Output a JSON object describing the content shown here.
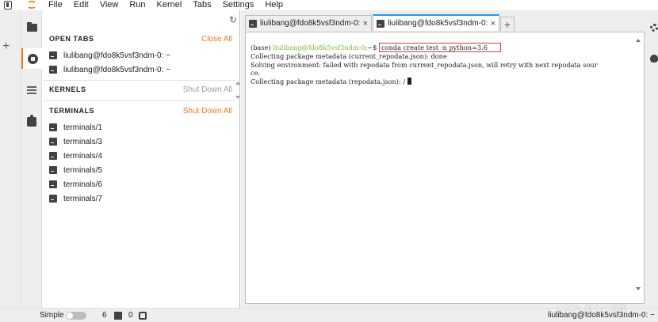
{
  "menubar": {
    "items": [
      "File",
      "Edit",
      "View",
      "Run",
      "Kernel",
      "Tabs",
      "Settings",
      "Help"
    ]
  },
  "icons": {
    "app": "window-icon",
    "logo": "jupyter-logo",
    "add_launcher": "plus-icon",
    "sidebar": [
      "folder-icon",
      "running-icon",
      "list-icon",
      "puzzle-icon"
    ],
    "right": [
      "gear-icon",
      "bug-icon"
    ]
  },
  "panel": {
    "open_tabs": {
      "title": "OPEN TABS",
      "action": "Close All",
      "items": [
        "liulibang@fdo8k5vsf3ndm-0: ~",
        "liulibang@fdo8k5vsf3ndm-0: ~"
      ]
    },
    "kernels": {
      "title": "KERNELS",
      "action": "Shut Down All"
    },
    "terminals": {
      "title": "TERMINALS",
      "action": "Shut Down All",
      "items": [
        "terminals/1",
        "terminals/3",
        "terminals/4",
        "terminals/5",
        "terminals/6",
        "terminals/7"
      ]
    }
  },
  "tabs": [
    {
      "label": "liulibang@fdo8k5vsf3ndm-0:",
      "close": "×",
      "active": false
    },
    {
      "label": "liulibang@fdo8k5vsf3ndm-0:",
      "close": "×",
      "active": true
    }
  ],
  "add_tab": "+",
  "terminal": {
    "prompt_base": "(base) ",
    "prompt_user": "liulibang@fdo8k5vsf3ndm-0",
    "prompt_path": ":~$ ",
    "command": "conda create test -n python=3.6",
    "lines": [
      "Collecting package metadata (current_repodata.json): done",
      "Solving environment: failed with repodata from current_repodata.json, will retry with next repodata sour",
      "ce.",
      "Collecting package metadata (repodata.json): / "
    ]
  },
  "statusbar": {
    "mode": "Simple",
    "terminals_count": "6",
    "kernels_count": "0",
    "right_text": "liulibang@fdo8k5vsf3ndm-0: ~"
  },
  "watermark": "CSDN @小小猪啊"
}
